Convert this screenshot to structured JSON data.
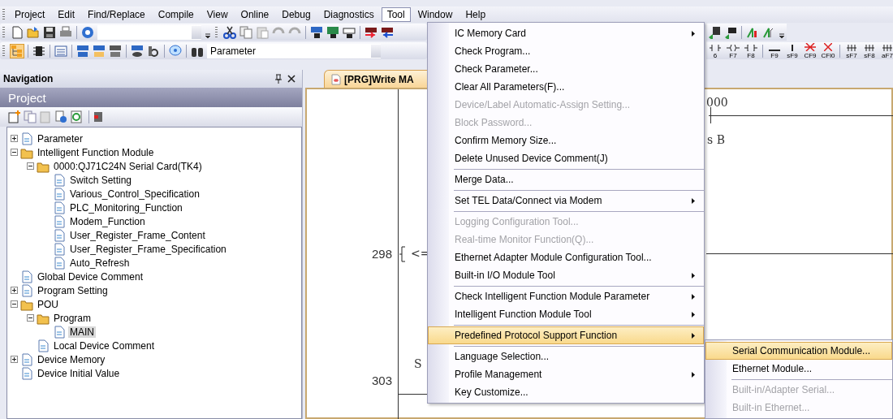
{
  "menu_bar": [
    {
      "label": "Project",
      "selected": false
    },
    {
      "label": "Edit",
      "selected": false
    },
    {
      "label": "Find/Replace",
      "selected": false
    },
    {
      "label": "Compile",
      "selected": false
    },
    {
      "label": "View",
      "selected": false
    },
    {
      "label": "Online",
      "selected": false
    },
    {
      "label": "Debug",
      "selected": false
    },
    {
      "label": "Diagnostics",
      "selected": false
    },
    {
      "label": "Tool",
      "selected": true
    },
    {
      "label": "Window",
      "selected": false
    },
    {
      "label": "Help",
      "selected": false
    }
  ],
  "toolbar": {
    "search_combo": {
      "value": "Parameter"
    },
    "key_labels": [
      "6",
      "F7",
      "F8",
      "F9",
      "sF9",
      "CF9",
      "CFl0",
      "sF7",
      "sF8",
      "aF7"
    ]
  },
  "navigation": {
    "title": "Navigation",
    "section": "Project",
    "tree": [
      {
        "label": "Parameter",
        "expanded": false,
        "selected": false
      },
      {
        "label": "Intelligent Function Module",
        "expanded": true,
        "selected": false,
        "children": [
          {
            "label": "0000:QJ71C24N  Serial Card(TK4)",
            "expanded": true,
            "selected": false,
            "children": [
              {
                "label": "Switch Setting",
                "selected": false
              },
              {
                "label": "Various_Control_Specification",
                "selected": false
              },
              {
                "label": "PLC_Monitoring_Function",
                "selected": false
              },
              {
                "label": "Modem_Function",
                "selected": false
              },
              {
                "label": "User_Register_Frame_Content",
                "selected": false
              },
              {
                "label": "User_Register_Frame_Specification",
                "selected": false
              },
              {
                "label": "Auto_Refresh",
                "selected": false
              }
            ]
          }
        ]
      },
      {
        "label": "Global Device Comment",
        "selected": false
      },
      {
        "label": "Program Setting",
        "expanded": false,
        "selected": false
      },
      {
        "label": "POU",
        "expanded": true,
        "selected": false,
        "children": [
          {
            "label": "Program",
            "expanded": true,
            "selected": false,
            "children": [
              {
                "label": "MAIN",
                "selected": true
              }
            ]
          },
          {
            "label": "Local Device Comment",
            "selected": false
          }
        ]
      },
      {
        "label": "Device Memory",
        "expanded": false,
        "selected": false
      },
      {
        "label": "Device Initial Value",
        "selected": false
      }
    ]
  },
  "editor": {
    "tab": "[PRG]Write MA",
    "line_numbers": [
      "298",
      "303"
    ],
    "ladder_texts": [
      "000",
      "s B",
      "<=",
      "S"
    ]
  },
  "tool_menu": {
    "items": [
      {
        "kind": "item",
        "label": "IC Memory Card",
        "disabled": false,
        "submenu": true,
        "selected": false
      },
      {
        "kind": "item",
        "label": "Check Program...",
        "disabled": false,
        "submenu": false,
        "selected": false
      },
      {
        "kind": "item",
        "label": "Check Parameter...",
        "disabled": false,
        "submenu": false,
        "selected": false
      },
      {
        "kind": "item",
        "label": "Clear All Parameters(F)...",
        "disabled": false,
        "submenu": false,
        "selected": false
      },
      {
        "kind": "item",
        "label": "Device/Label Automatic-Assign Setting...",
        "disabled": true,
        "submenu": false,
        "selected": false
      },
      {
        "kind": "item",
        "label": "Block Password...",
        "disabled": true,
        "submenu": false,
        "selected": false
      },
      {
        "kind": "item",
        "label": "Confirm Memory Size...",
        "disabled": false,
        "submenu": false,
        "selected": false
      },
      {
        "kind": "item",
        "label": "Delete Unused Device Comment(J)",
        "disabled": false,
        "submenu": false,
        "selected": false
      },
      {
        "kind": "separator"
      },
      {
        "kind": "item",
        "label": "Merge Data...",
        "disabled": false,
        "submenu": false,
        "selected": false
      },
      {
        "kind": "separator"
      },
      {
        "kind": "item",
        "label": "Set TEL Data/Connect via Modem",
        "disabled": false,
        "submenu": true,
        "selected": false
      },
      {
        "kind": "separator"
      },
      {
        "kind": "item",
        "label": "Logging Configuration Tool...",
        "disabled": true,
        "submenu": false,
        "selected": false
      },
      {
        "kind": "item",
        "label": "Real-time Monitor Function(Q)...",
        "disabled": true,
        "submenu": false,
        "selected": false
      },
      {
        "kind": "item",
        "label": "Ethernet Adapter Module Configuration Tool...",
        "disabled": false,
        "submenu": false,
        "selected": false
      },
      {
        "kind": "item",
        "label": "Built-in I/O Module Tool",
        "disabled": false,
        "submenu": true,
        "selected": false
      },
      {
        "kind": "separator"
      },
      {
        "kind": "item",
        "label": "Check Intelligent Function Module Parameter",
        "disabled": false,
        "submenu": true,
        "selected": false
      },
      {
        "kind": "item",
        "label": "Intelligent Function Module Tool",
        "disabled": false,
        "submenu": true,
        "selected": false
      },
      {
        "kind": "separator"
      },
      {
        "kind": "item",
        "label": "Predefined Protocol Support Function",
        "disabled": false,
        "submenu": true,
        "selected": true
      },
      {
        "kind": "separator"
      },
      {
        "kind": "item",
        "label": "Language Selection...",
        "disabled": false,
        "submenu": false,
        "selected": false
      },
      {
        "kind": "item",
        "label": "Profile Management",
        "disabled": false,
        "submenu": true,
        "selected": false
      },
      {
        "kind": "item",
        "label": "Key Customize...",
        "disabled": false,
        "submenu": false,
        "selected": false
      }
    ]
  },
  "submenu": {
    "items": [
      {
        "kind": "item",
        "label": "Serial Communication Module...",
        "disabled": false,
        "selected": true
      },
      {
        "kind": "item",
        "label": "Ethernet Module...",
        "disabled": false,
        "selected": false
      },
      {
        "kind": "separator"
      },
      {
        "kind": "item",
        "label": "Built-in/Adapter Serial...",
        "disabled": true,
        "selected": false
      },
      {
        "kind": "item",
        "label": "Built-in Ethernet...",
        "disabled": true,
        "selected": false
      }
    ]
  }
}
